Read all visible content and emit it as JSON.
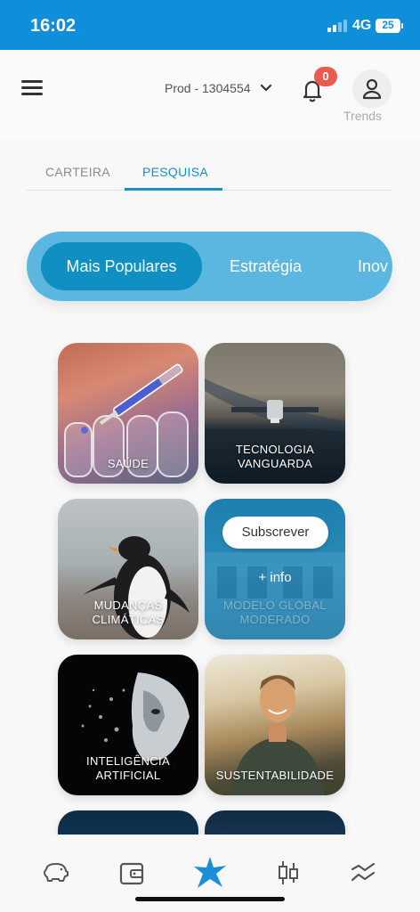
{
  "status_bar": {
    "time": "16:02",
    "network": "4G",
    "battery": "25"
  },
  "header": {
    "account_label": "Prod - 1304554",
    "notification_count": "0",
    "trends_label": "Trends"
  },
  "tabs": [
    {
      "label": "CARTEIRA"
    },
    {
      "label": "PESQUISA",
      "active": true
    }
  ],
  "categories": [
    {
      "label": "Mais Populares",
      "active": true
    },
    {
      "label": "Estratégia"
    },
    {
      "label": "Inov"
    }
  ],
  "tiles": [
    {
      "label_line1": "SAÚDE",
      "label_line2": ""
    },
    {
      "label_line1": "TECNOLOGIA",
      "label_line2": "VANGUARDA"
    },
    {
      "label_line1": "MUDANÇAS",
      "label_line2": "CLIMÁTICAS"
    },
    {
      "label_line1": "MODELO GLOBAL",
      "label_line2": "MODERADO",
      "subscribe_label": "Subscrever",
      "more_info_label": "+ info"
    },
    {
      "label_line1": "INTELIGÊNCIA",
      "label_line2": "ARTIFICIAL"
    },
    {
      "label_line1": "SUSTENTABILIDADE",
      "label_line2": ""
    }
  ],
  "bottom_nav": [
    {
      "icon": "piggy-bank-icon"
    },
    {
      "icon": "wallet-icon"
    },
    {
      "icon": "star-icon",
      "active": true
    },
    {
      "icon": "candlestick-icon"
    },
    {
      "icon": "trend-lines-icon"
    }
  ],
  "colors": {
    "brand_blue": "#0f8fd9",
    "tab_accent": "#1a8cc8",
    "pill_bg": "#5bb7df",
    "pill_active": "#0f8fc2",
    "badge_red": "#ea5b4f"
  }
}
